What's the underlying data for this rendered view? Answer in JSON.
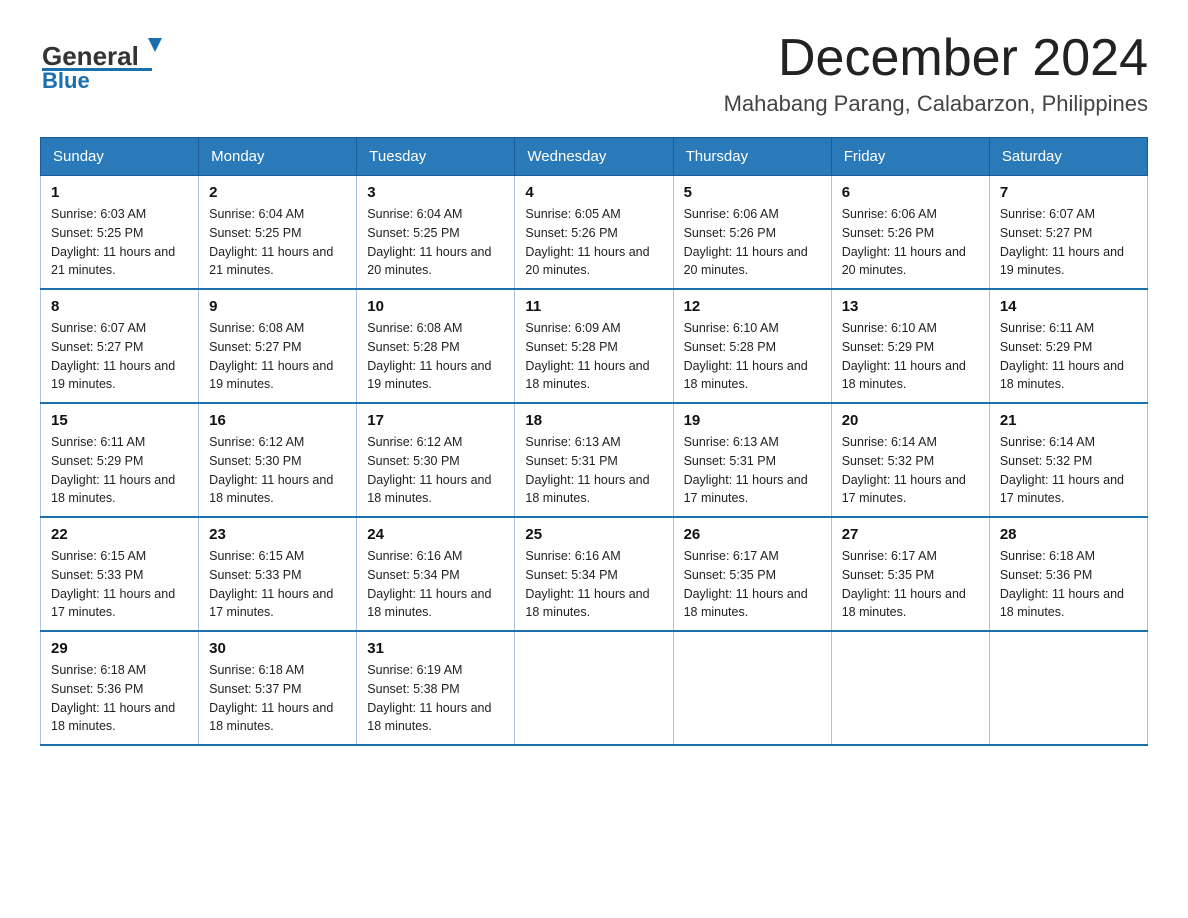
{
  "header": {
    "logo_general": "General",
    "logo_blue": "Blue",
    "title": "December 2024",
    "subtitle": "Mahabang Parang, Calabarzon, Philippines"
  },
  "calendar": {
    "days_of_week": [
      "Sunday",
      "Monday",
      "Tuesday",
      "Wednesday",
      "Thursday",
      "Friday",
      "Saturday"
    ],
    "weeks": [
      [
        {
          "day": "1",
          "sunrise": "6:03 AM",
          "sunset": "5:25 PM",
          "daylight": "11 hours and 21 minutes."
        },
        {
          "day": "2",
          "sunrise": "6:04 AM",
          "sunset": "5:25 PM",
          "daylight": "11 hours and 21 minutes."
        },
        {
          "day": "3",
          "sunrise": "6:04 AM",
          "sunset": "5:25 PM",
          "daylight": "11 hours and 20 minutes."
        },
        {
          "day": "4",
          "sunrise": "6:05 AM",
          "sunset": "5:26 PM",
          "daylight": "11 hours and 20 minutes."
        },
        {
          "day": "5",
          "sunrise": "6:06 AM",
          "sunset": "5:26 PM",
          "daylight": "11 hours and 20 minutes."
        },
        {
          "day": "6",
          "sunrise": "6:06 AM",
          "sunset": "5:26 PM",
          "daylight": "11 hours and 20 minutes."
        },
        {
          "day": "7",
          "sunrise": "6:07 AM",
          "sunset": "5:27 PM",
          "daylight": "11 hours and 19 minutes."
        }
      ],
      [
        {
          "day": "8",
          "sunrise": "6:07 AM",
          "sunset": "5:27 PM",
          "daylight": "11 hours and 19 minutes."
        },
        {
          "day": "9",
          "sunrise": "6:08 AM",
          "sunset": "5:27 PM",
          "daylight": "11 hours and 19 minutes."
        },
        {
          "day": "10",
          "sunrise": "6:08 AM",
          "sunset": "5:28 PM",
          "daylight": "11 hours and 19 minutes."
        },
        {
          "day": "11",
          "sunrise": "6:09 AM",
          "sunset": "5:28 PM",
          "daylight": "11 hours and 18 minutes."
        },
        {
          "day": "12",
          "sunrise": "6:10 AM",
          "sunset": "5:28 PM",
          "daylight": "11 hours and 18 minutes."
        },
        {
          "day": "13",
          "sunrise": "6:10 AM",
          "sunset": "5:29 PM",
          "daylight": "11 hours and 18 minutes."
        },
        {
          "day": "14",
          "sunrise": "6:11 AM",
          "sunset": "5:29 PM",
          "daylight": "11 hours and 18 minutes."
        }
      ],
      [
        {
          "day": "15",
          "sunrise": "6:11 AM",
          "sunset": "5:29 PM",
          "daylight": "11 hours and 18 minutes."
        },
        {
          "day": "16",
          "sunrise": "6:12 AM",
          "sunset": "5:30 PM",
          "daylight": "11 hours and 18 minutes."
        },
        {
          "day": "17",
          "sunrise": "6:12 AM",
          "sunset": "5:30 PM",
          "daylight": "11 hours and 18 minutes."
        },
        {
          "day": "18",
          "sunrise": "6:13 AM",
          "sunset": "5:31 PM",
          "daylight": "11 hours and 18 minutes."
        },
        {
          "day": "19",
          "sunrise": "6:13 AM",
          "sunset": "5:31 PM",
          "daylight": "11 hours and 17 minutes."
        },
        {
          "day": "20",
          "sunrise": "6:14 AM",
          "sunset": "5:32 PM",
          "daylight": "11 hours and 17 minutes."
        },
        {
          "day": "21",
          "sunrise": "6:14 AM",
          "sunset": "5:32 PM",
          "daylight": "11 hours and 17 minutes."
        }
      ],
      [
        {
          "day": "22",
          "sunrise": "6:15 AM",
          "sunset": "5:33 PM",
          "daylight": "11 hours and 17 minutes."
        },
        {
          "day": "23",
          "sunrise": "6:15 AM",
          "sunset": "5:33 PM",
          "daylight": "11 hours and 17 minutes."
        },
        {
          "day": "24",
          "sunrise": "6:16 AM",
          "sunset": "5:34 PM",
          "daylight": "11 hours and 18 minutes."
        },
        {
          "day": "25",
          "sunrise": "6:16 AM",
          "sunset": "5:34 PM",
          "daylight": "11 hours and 18 minutes."
        },
        {
          "day": "26",
          "sunrise": "6:17 AM",
          "sunset": "5:35 PM",
          "daylight": "11 hours and 18 minutes."
        },
        {
          "day": "27",
          "sunrise": "6:17 AM",
          "sunset": "5:35 PM",
          "daylight": "11 hours and 18 minutes."
        },
        {
          "day": "28",
          "sunrise": "6:18 AM",
          "sunset": "5:36 PM",
          "daylight": "11 hours and 18 minutes."
        }
      ],
      [
        {
          "day": "29",
          "sunrise": "6:18 AM",
          "sunset": "5:36 PM",
          "daylight": "11 hours and 18 minutes."
        },
        {
          "day": "30",
          "sunrise": "6:18 AM",
          "sunset": "5:37 PM",
          "daylight": "11 hours and 18 minutes."
        },
        {
          "day": "31",
          "sunrise": "6:19 AM",
          "sunset": "5:38 PM",
          "daylight": "11 hours and 18 minutes."
        },
        null,
        null,
        null,
        null
      ]
    ],
    "sunrise_label": "Sunrise:",
    "sunset_label": "Sunset:",
    "daylight_label": "Daylight:"
  }
}
